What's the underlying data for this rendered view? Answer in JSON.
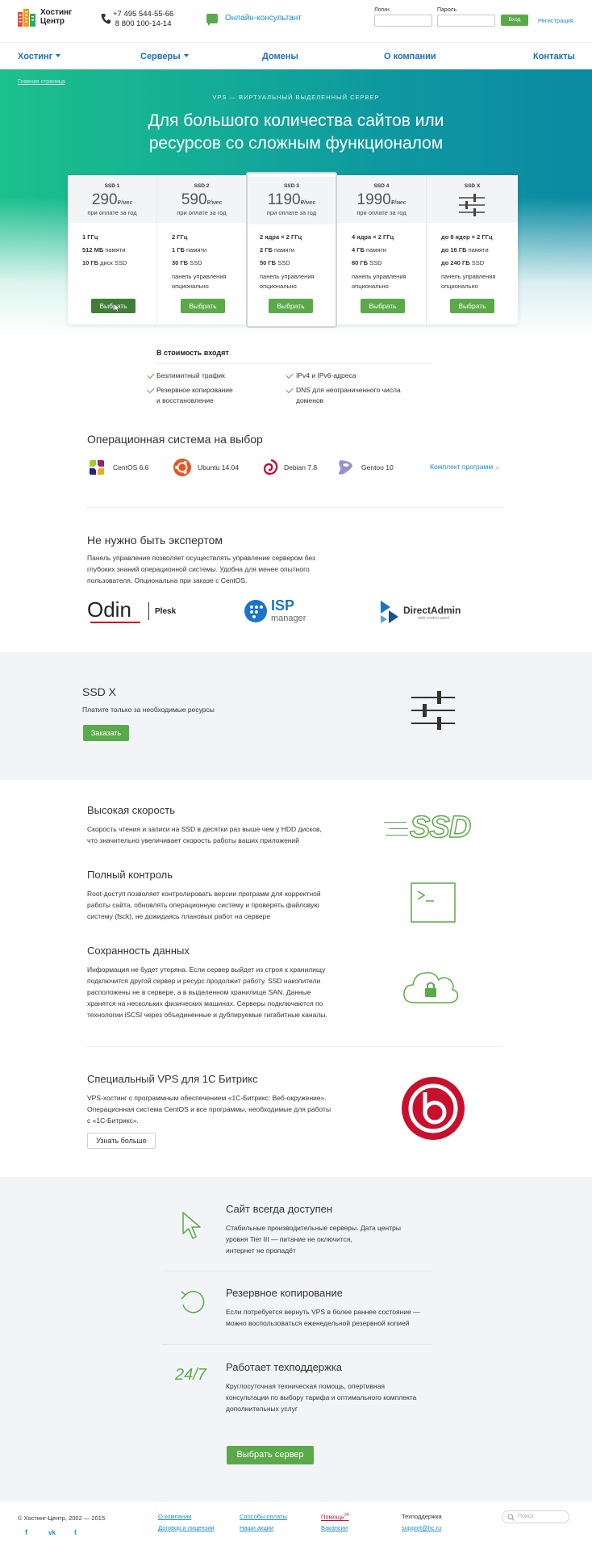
{
  "header": {
    "logo_line1": "Хостинг",
    "logo_line2": "Центр",
    "phone1": "+7 495 544-55-66",
    "phone2": "8 800 100-14-14",
    "chat_label": "Онлайн-консультант",
    "login_label": "Логин",
    "password_label": "Пароль",
    "login_button": "Вход",
    "register_link": "Регистрация"
  },
  "nav": {
    "items": [
      {
        "label": "Хостинг"
      },
      {
        "label": "Серверы"
      },
      {
        "label": "Домены"
      },
      {
        "label": "О компании"
      },
      {
        "label": "Контакты"
      }
    ]
  },
  "hero": {
    "breadcrumb": "Главная страница",
    "subtitle": "VPS — ВИРТУАЛЬНЫЙ ВЫДЕЛЕННЫЙ СЕРВЕР",
    "title_line1": "Для большого количества сайтов или",
    "title_line2": "ресурсов со сложным функционалом"
  },
  "plans": [
    {
      "name": "SSD 1",
      "price": "290",
      "unit": "₽/мес",
      "note": "при оплате за год",
      "spec1_b": "1 ГГц",
      "spec1": "",
      "spec2_b": "512 МБ",
      "spec2": " памяти",
      "spec3_b": "10 ГБ",
      "spec3": " диск SSD",
      "spec4": "",
      "spec5": "",
      "button": "Выбрать"
    },
    {
      "name": "SSD 2",
      "price": "590",
      "unit": "₽/мес",
      "note": "при оплате за год",
      "spec1_b": "2 ГГц",
      "spec1": "",
      "spec2_b": "1 ГБ",
      "spec2": " памяти",
      "spec3_b": "30 ГБ",
      "spec3": " SSD",
      "spec4": "панель управления",
      "spec5": "опционально",
      "button": "Выбрать"
    },
    {
      "name": "SSD 3",
      "price": "1190",
      "unit": "₽/мес",
      "note": "при оплате за год",
      "spec1_b": "2 ядра × 2 ГГц",
      "spec1": "",
      "spec2_b": "2 ГБ",
      "spec2": " памяти",
      "spec3_b": "50 ГБ",
      "spec3": " SSD",
      "spec4": "панель управления",
      "spec5": "опционально",
      "button": "Выбрать"
    },
    {
      "name": "SSD 4",
      "price": "1990",
      "unit": "₽/мес",
      "note": "при оплате за год",
      "spec1_b": "4 ядра × 2 ГГц",
      "spec1": "",
      "spec2_b": "4 ГБ",
      "spec2": " памяти",
      "spec3_b": "80 ГБ",
      "spec3": " SSD",
      "spec4": "панель управления",
      "spec5": "опционально",
      "button": "Выбрать"
    },
    {
      "name": "SSD X",
      "price": "",
      "unit": "",
      "note": "",
      "spec1_b": "до 8 ядер × 2 ГГц",
      "spec1": "",
      "spec2_b": "до 16 ГБ",
      "spec2": " памяти",
      "spec3_b": "до 240 ГБ",
      "spec3": " SSD",
      "spec4": "панель управления",
      "spec5": "опционально",
      "button": "Выбрать"
    }
  ],
  "included": {
    "title": "В стоимость входят",
    "items": [
      "Безлимитный трафик",
      "IPv4 и IPv6-адреса",
      "Резервное копирование",
      "и восстановление",
      "DNS для неограниченного числа",
      "доменов"
    ]
  },
  "os": {
    "title": "Операционная система на выбор",
    "items": [
      "CentOS 6.6",
      "Ubuntu 14.04",
      "Debian 7.8",
      "Gentoo 10"
    ],
    "more": "Комплект программ"
  },
  "panel": {
    "title": "Не нужно быть экспертом",
    "text1": "Панель управления позволяет осуществлять управление сервером без",
    "text2": "глубоких знаний операционной системы. Удобна для менее опытного",
    "text3": "пользователя. Опциональна при заказе с CentOS.",
    "logo1": "Odin",
    "logo1b": "Plesk",
    "logo2": "ISP",
    "logo2b": "manager",
    "logo3": "DirectAdmin",
    "logo3b": "web control panel"
  },
  "ssdx": {
    "title": "SSD X",
    "text": "Платите только за необходимые ресурсы",
    "button": "Заказать"
  },
  "features": [
    {
      "title": "Высокая скорость",
      "l1": "Скорость чтения и записи на SSD в десятки раз выше чем у HDD дисков,",
      "l2": "что значительно увеличивает скорость работы ваших приложений",
      "l3": "",
      "l4": "",
      "l5": ""
    },
    {
      "title": "Полный контроль",
      "l1": "Root-доступ позволяет контролировать версии программ для корректной",
      "l2": "работы сайта, обновлять операционную систему и проверять файловую",
      "l3": "систему (fsck), не дожидаясь плановых работ на сервере",
      "l4": "",
      "l5": ""
    },
    {
      "title": "Сохранность данных",
      "l1": "Информация не будет утеряна. Если сервер выйдет  из строя к хранилищу",
      "l2": "подключится другой сервер и ресурс продолжит работу. SSD накопители",
      "l3": "расположены не в сервере, а в выделенном хранилище SAN. Данные",
      "l4": "хранятся на нескольких физических машинах. Серверы подключаются по",
      "l5": "технологии iSCSI через объединенные и дублируемые гигабитные каналы."
    }
  ],
  "ssd_label": "SSD",
  "bitrix": {
    "title": "Специальный VPS для 1С Битрикс",
    "l1": "VPS-хостинг с программным обеспечением «1С-Битрикс: Веб-окружение».",
    "l2": "Операционная система CentOS и все программы, необходимые для работы",
    "l3": "с «1С-Битрикс».",
    "button": "Узнать больше"
  },
  "benefits": [
    {
      "title": "Сайт всегда доступен",
      "l1": "Стабильные производительные серверы. Дата центры",
      "l2": "уровня Tier III — питание не оключится,",
      "l3": "интернет не пропадёт"
    },
    {
      "title": "Резервное копирование",
      "l1": "Если потребуется вернуть VPS в более раннее состояние —",
      "l2": "можно воспользоваться еженедельной резервной копией",
      "l3": ""
    },
    {
      "title": "Работает техподдержка",
      "l1": "Круглосуточная техническая помощь, опертивная",
      "l2": "консультации по выбору тарифа и оптимального комплекта",
      "l3": "дополнительных услуг"
    }
  ],
  "benefit_icon_247": "24/7",
  "cta_button": "Выбрать сервер",
  "footer": {
    "copyright": "© Хостинг-Центр, 2002 — 2015",
    "links": [
      "О компании",
      "Договор и лицензии",
      "Способы оплаты",
      "Наши акции",
      "Помощь",
      "Вакансии"
    ],
    "help_badge": "24",
    "support_title": "Техподдержка",
    "support_email": "support@hc.ru",
    "search_placeholder": "Поиск",
    "social": [
      "f",
      "vk",
      "t"
    ]
  },
  "colors": {
    "green": "#5aaa4a",
    "link": "#1c8ccf",
    "nav": "#1a6fbf",
    "teal_start": "#1cc08b",
    "teal_end": "#0b8aa3"
  }
}
